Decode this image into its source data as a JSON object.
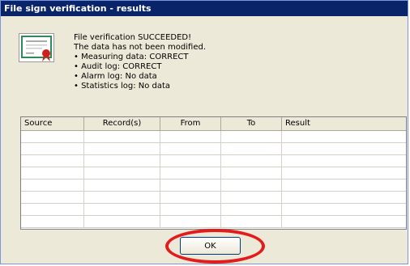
{
  "window": {
    "title": "File sign verification - results"
  },
  "message": {
    "line1": "File verification SUCCEEDED!",
    "line2": "The data has not been modified.",
    "items": [
      "• Measuring data: CORRECT",
      "• Audit log: CORRECT",
      "• Alarm log: No data",
      "• Statistics log: No data"
    ]
  },
  "table": {
    "columns": [
      "Source",
      "Record(s)",
      "From",
      "To",
      "Result"
    ],
    "rows": []
  },
  "buttons": {
    "ok_label": "OK"
  },
  "icons": {
    "certificate": "certificate-icon"
  },
  "colors": {
    "titlebar": "#0a246a",
    "highlight_ring": "#e21c1c"
  }
}
